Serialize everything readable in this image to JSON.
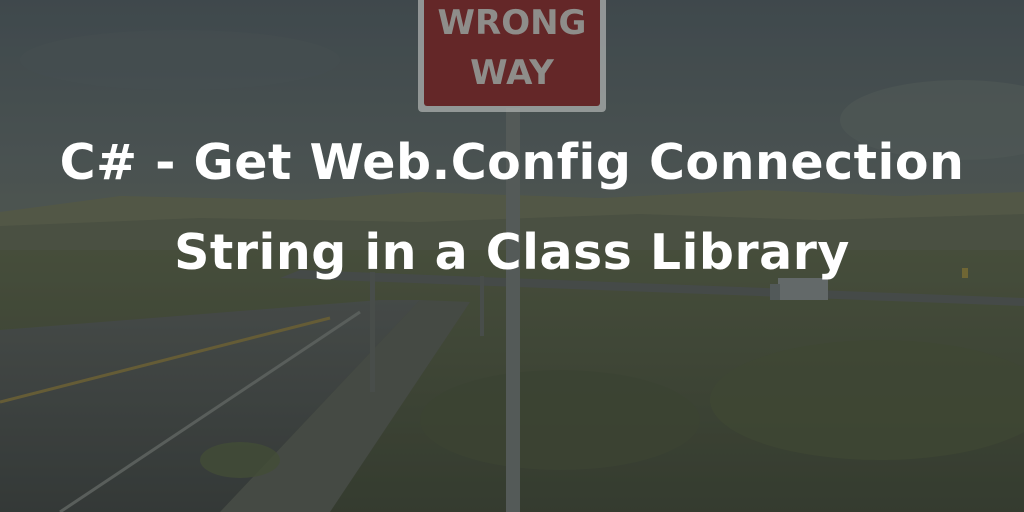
{
  "scene": {
    "sign_line_1": "WRONG",
    "sign_line_2": "WAY",
    "colors": {
      "sky": "#55606b",
      "sign_red": "#8c2428",
      "road": "#4b4f4f",
      "grass": "#586044"
    }
  },
  "title": {
    "text": "C# - Get Web.Config Connection String in a Class Library"
  }
}
